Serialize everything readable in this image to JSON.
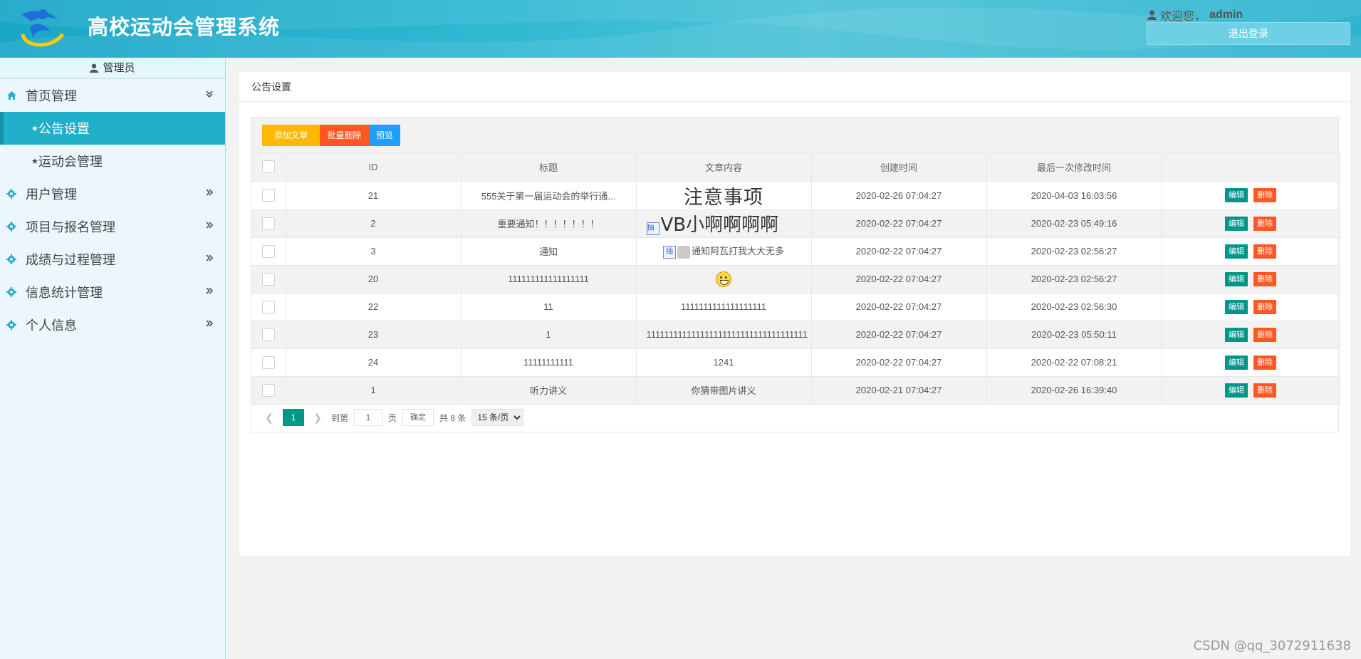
{
  "header": {
    "title": "高校运动会管理系统",
    "welcome_prefix": "欢迎您，",
    "username": "admin",
    "logout_label": "退出登录"
  },
  "sidebar": {
    "role": "管理员",
    "menus": [
      {
        "label": "首页管理",
        "icon": "home-icon",
        "expanded": true,
        "children": [
          {
            "label": "公告设置",
            "active": true
          },
          {
            "label": "运动会管理",
            "active": false
          }
        ]
      },
      {
        "label": "用户管理",
        "icon": "gear-icon"
      },
      {
        "label": "项目与报名管理",
        "icon": "gear-icon"
      },
      {
        "label": "成绩与过程管理",
        "icon": "gear-icon"
      },
      {
        "label": "信息统计管理",
        "icon": "gear-icon"
      },
      {
        "label": "个人信息",
        "icon": "gear-icon"
      }
    ]
  },
  "main": {
    "panel_title": "公告设置",
    "toolbar": {
      "add_label": "添加文章",
      "batch_delete_label": "批量删除",
      "preview_label": "预览"
    },
    "columns": [
      "ID",
      "标题",
      "文章内容",
      "创建时间",
      "最后一次修改时间"
    ],
    "row_actions": {
      "edit": "编辑",
      "delete": "删除"
    },
    "rows": [
      {
        "id": "21",
        "title": "555关于第一届运动会的举行通...",
        "content": "注意事项",
        "created": "2020-02-26 07:04:27",
        "modified": "2020-04-03 16:03:56"
      },
      {
        "id": "2",
        "title": "重要通知！！！！！！！",
        "content": "VB小啊啊啊啊",
        "created": "2020-02-22 07:04:27",
        "modified": "2020-02-23 05:49:16"
      },
      {
        "id": "3",
        "title": "通知",
        "content": "通知阿瓦打我大大无多",
        "created": "2020-02-22 07:04:27",
        "modified": "2020-02-23 02:56:27"
      },
      {
        "id": "20",
        "title": "111111111111111111",
        "content": "",
        "created": "2020-02-22 07:04:27",
        "modified": "2020-02-23 02:56:27"
      },
      {
        "id": "22",
        "title": "11",
        "content": "1111111111111111111",
        "created": "2020-02-22 07:04:27",
        "modified": "2020-02-23 02:56:30"
      },
      {
        "id": "23",
        "title": "1",
        "content": "111111111111111111111111111111111111",
        "created": "2020-02-22 07:04:27",
        "modified": "2020-02-23 05:50:11"
      },
      {
        "id": "24",
        "title": "11111111111",
        "content": "1241",
        "created": "2020-02-22 07:04:27",
        "modified": "2020-02-22 07:08:21"
      },
      {
        "id": "1",
        "title": "听力讲义",
        "content": "你猜带图片讲义",
        "created": "2020-02-21 07:04:27",
        "modified": "2020-02-26 16:39:40"
      }
    ],
    "pager": {
      "current_page": "1",
      "goto_label": "到第",
      "goto_value": "1",
      "page_unit": "页",
      "confirm_label": "确定",
      "total_text": "共 8 条",
      "page_size": "15 条/页"
    }
  },
  "watermark": "CSDN @qq_3072911638",
  "colors": {
    "header": "#2fb8d2",
    "active_menu": "#22afc9",
    "add": "#ffb800",
    "delete": "#ff5722",
    "preview": "#1e9fff",
    "edit": "#009688"
  }
}
